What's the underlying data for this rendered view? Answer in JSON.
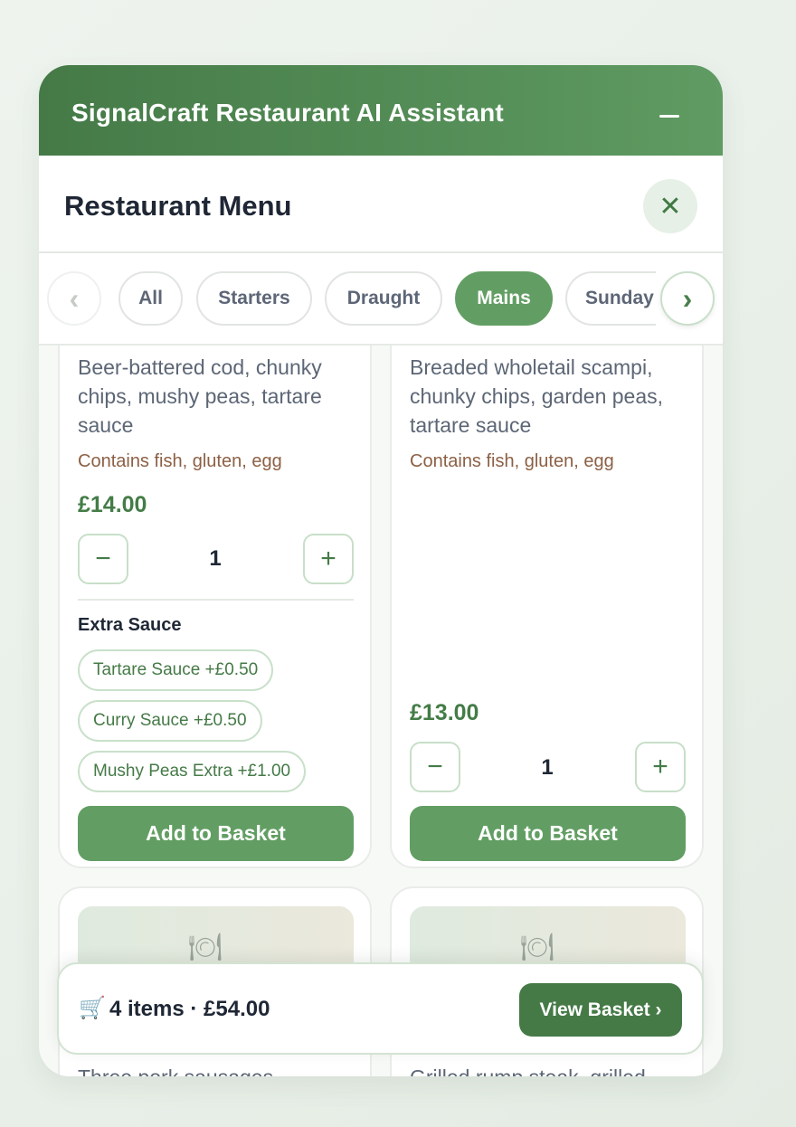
{
  "header": {
    "title": "SignalCraft Restaurant AI Assistant",
    "minimize_icon": "minus-icon"
  },
  "menu": {
    "title": "Restaurant Menu",
    "close_glyph": "✕"
  },
  "tabs": {
    "prev_glyph": "‹",
    "next_glyph": "›",
    "items": [
      {
        "label": "All",
        "active": false
      },
      {
        "label": "Starters",
        "active": false
      },
      {
        "label": "Draught",
        "active": false
      },
      {
        "label": "Mains",
        "active": true
      },
      {
        "label": "Sunday",
        "active": false
      }
    ]
  },
  "items": [
    {
      "description": "Beer-battered cod, chunky chips, mushy peas, tartare sauce",
      "allergens": "Contains fish, gluten, egg",
      "price": "£14.00",
      "quantity": "1",
      "extras_title": "Extra Sauce",
      "extras": [
        "Tartare Sauce +£0.50",
        "Curry Sauce +£0.50",
        "Mushy Peas Extra +£1.00"
      ],
      "add_label": "Add to Basket"
    },
    {
      "description": "Breaded wholetail scampi, chunky chips, garden peas, tartare sauce",
      "allergens": "Contains fish, gluten, egg",
      "price": "£13.00",
      "quantity": "1",
      "add_label": "Add to Basket"
    },
    {
      "image_icon": "plate-icon",
      "description_partial": "Three pork sausages"
    },
    {
      "image_icon": "plate-icon",
      "description_partial": "Grilled rump steak, grilled"
    }
  ],
  "controls": {
    "minus_glyph": "−",
    "plus_glyph": "+",
    "plate_glyph": "🍽"
  },
  "basket": {
    "cart_glyph": "🛒",
    "summary": "4 items · £54.00",
    "view_label": "View Basket ›"
  }
}
